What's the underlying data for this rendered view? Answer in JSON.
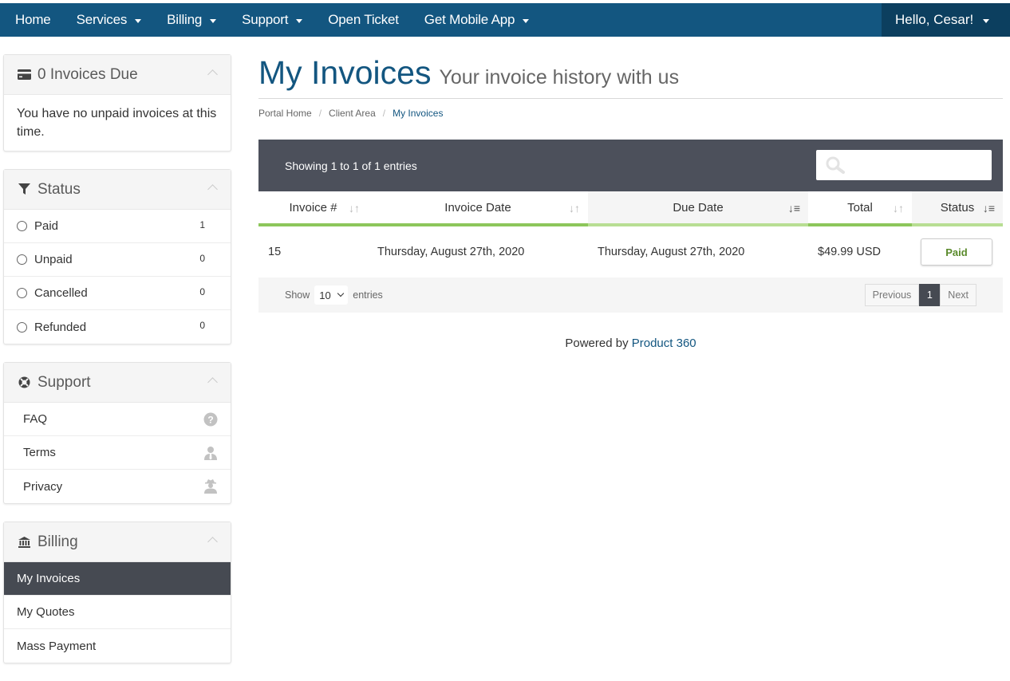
{
  "nav": {
    "items": [
      {
        "label": "Home",
        "dropdown": false
      },
      {
        "label": "Services",
        "dropdown": true
      },
      {
        "label": "Billing",
        "dropdown": true
      },
      {
        "label": "Support",
        "dropdown": true
      },
      {
        "label": "Open Ticket",
        "dropdown": false
      },
      {
        "label": "Get Mobile App",
        "dropdown": true
      }
    ],
    "user_label": "Hello, Cesar!"
  },
  "sidebar": {
    "invoices_due": {
      "title": "0 Invoices Due",
      "icon": "credit-card-icon",
      "body": "You have no unpaid invoices at this time."
    },
    "status": {
      "title": "Status",
      "icon": "filter-icon",
      "items": [
        {
          "label": "Paid",
          "count": "1"
        },
        {
          "label": "Unpaid",
          "count": "0"
        },
        {
          "label": "Cancelled",
          "count": "0"
        },
        {
          "label": "Refunded",
          "count": "0"
        }
      ]
    },
    "support": {
      "title": "Support",
      "icon": "life-ring-icon",
      "items": [
        {
          "label": "FAQ",
          "icon": "question-circle-icon"
        },
        {
          "label": "Terms",
          "icon": "user-tie-icon"
        },
        {
          "label": "Privacy",
          "icon": "user-secret-icon"
        }
      ]
    },
    "billing": {
      "title": "Billing",
      "icon": "bank-icon",
      "items": [
        {
          "label": "My Invoices",
          "active": true
        },
        {
          "label": "My Quotes",
          "active": false
        },
        {
          "label": "Mass Payment",
          "active": false
        }
      ]
    }
  },
  "main": {
    "title": "My Invoices",
    "subtitle": "Your invoice history with us",
    "breadcrumb": [
      "Portal Home",
      "Client Area",
      "My Invoices"
    ],
    "showing_text": "Showing 1 to 1 of 1 entries",
    "search_placeholder": "",
    "columns": [
      "Invoice #",
      "Invoice Date",
      "Due Date",
      "Total",
      "Status"
    ],
    "rows": [
      {
        "invoice": "15",
        "invoice_date": "Thursday, August 27th, 2020",
        "due_date": "Thursday, August 27th, 2020",
        "total": "$49.99 USD",
        "status": "Paid"
      }
    ],
    "show_label": "Show",
    "page_length": "10",
    "entries_label": "entries",
    "pager": {
      "previous": "Previous",
      "current": "1",
      "next": "Next"
    },
    "powered_by": "Powered by",
    "powered_link": "Product 360"
  },
  "colors": {
    "nav_bg": "#135680",
    "user_bg": "#0c3f5f",
    "table_bar_bg": "#4c505b",
    "header_accent": "#8dc65b",
    "paid_text": "#5a8a2b"
  }
}
